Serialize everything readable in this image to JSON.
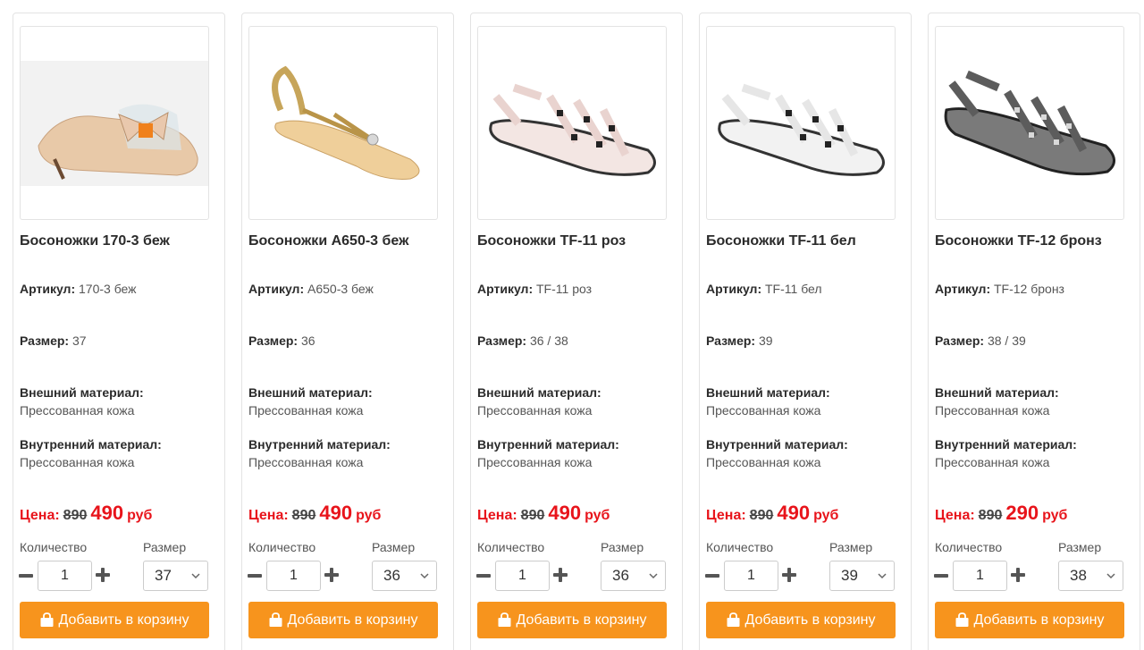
{
  "labels": {
    "article": "Артикул:",
    "size": "Размер:",
    "outer_material": "Внешний материал:",
    "inner_material": "Внутренний материал:",
    "price": "Цена:",
    "currency": "руб",
    "quantity": "Количество",
    "size_select": "Размер",
    "add_to_cart": "Добавить в корзину"
  },
  "colors": {
    "accent": "#f7941d",
    "price": "#e8141b"
  },
  "products": [
    {
      "title": "Босоножки 170-3 беж",
      "article": "170-3 беж",
      "size": "37",
      "outer": "Прессованная кожа",
      "inner": "Прессованная кожа",
      "old_price": "890",
      "price": "490",
      "qty": "1",
      "selected_size": "37",
      "image": "beige-bow-sandal"
    },
    {
      "title": "Босоножки A650-3 беж",
      "article": "A650-3 беж",
      "size": "36",
      "outer": "Прессованная кожа",
      "inner": "Прессованная кожа",
      "old_price": "890",
      "price": "490",
      "qty": "1",
      "selected_size": "36",
      "image": "beige-thong-sandal"
    },
    {
      "title": "Босоножки TF-11 роз",
      "article": "TF-11 роз",
      "size": "36 / 38",
      "outer": "Прессованная кожа",
      "inner": "Прессованная кожа",
      "old_price": "890",
      "price": "490",
      "qty": "1",
      "selected_size": "36",
      "image": "pink-studded-sandal"
    },
    {
      "title": "Босоножки TF-11 бел",
      "article": "TF-11 бел",
      "size": "39",
      "outer": "Прессованная кожа",
      "inner": "Прессованная кожа",
      "old_price": "890",
      "price": "490",
      "qty": "1",
      "selected_size": "39",
      "image": "white-studded-sandal"
    },
    {
      "title": "Босоножки TF-12 бронз",
      "article": "TF-12 бронз",
      "size": "38 / 39",
      "outer": "Прессованная кожа",
      "inner": "Прессованная кожа",
      "old_price": "890",
      "price": "290",
      "qty": "1",
      "selected_size": "38",
      "image": "bronze-studded-sandal"
    }
  ]
}
